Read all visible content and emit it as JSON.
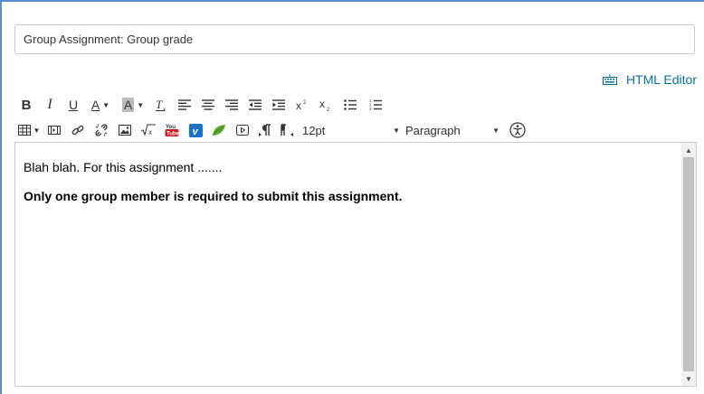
{
  "title_field": {
    "value": "Group Assignment: Group grade"
  },
  "html_editor": {
    "label": "HTML Editor",
    "icon": "keyboard-icon"
  },
  "toolbar": {
    "bold": "B",
    "italic": "I",
    "underline": "U",
    "text_color": "A",
    "background_color": "A",
    "font_size": "12pt",
    "format": "Paragraph"
  },
  "content": {
    "paragraphs": [
      "Blah blah. For this assignment .......",
      "Only one group member is required to submit this assignment."
    ]
  },
  "colors": {
    "accent": "#0770a3",
    "frame": "#5b8ac9",
    "border": "#c7cdd1"
  }
}
